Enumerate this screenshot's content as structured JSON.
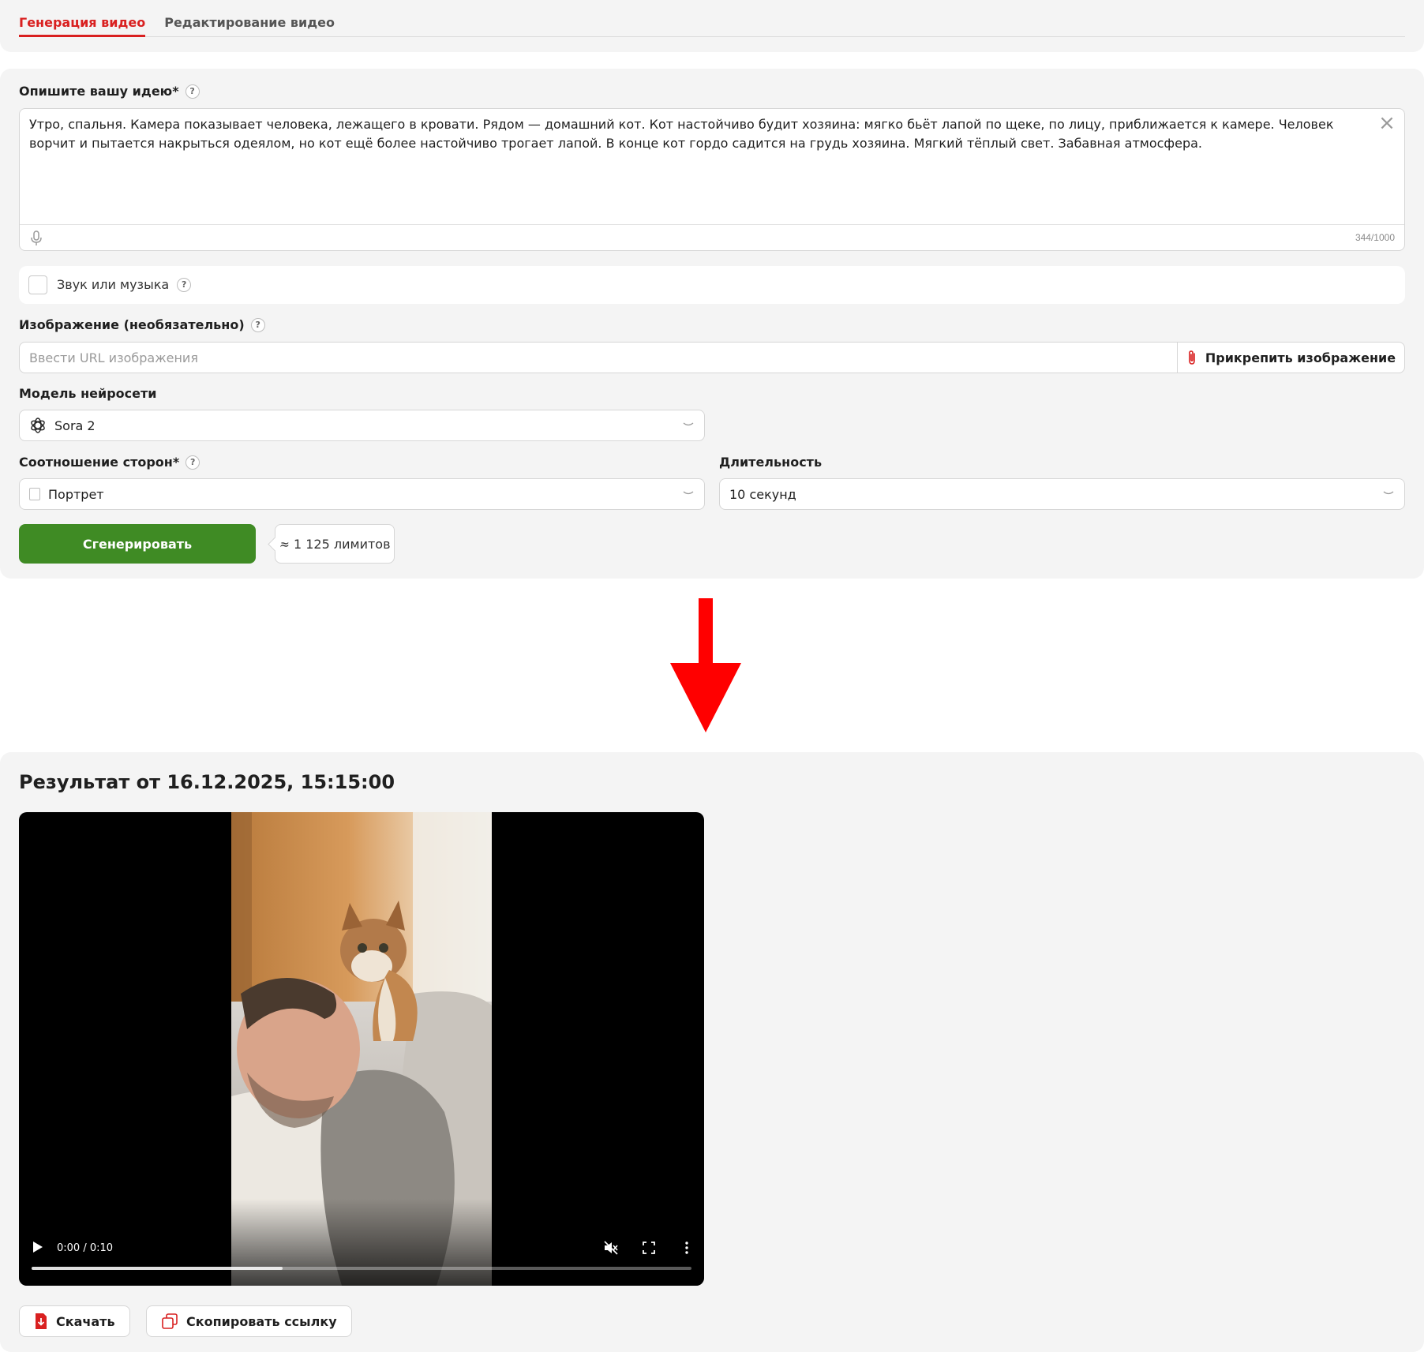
{
  "tabs": [
    {
      "label": "Генерация видео",
      "active": true
    },
    {
      "label": "Редактирование видео",
      "active": false
    }
  ],
  "idea": {
    "label": "Опишите вашу идею*",
    "help": "?",
    "value": "Утро, спальня. Камера показывает человека, лежащего в кровати. Рядом — домашний кот. Кот настойчиво будит хозяина: мягко бьёт лапой по щеке, по лицу, приближается к камере. Человек ворчит и пытается накрыться одеялом, но кот ещё более настойчиво трогает лапой. В конце кот гордо садится на грудь хозяина. Мягкий тёплый свет. Забавная атмосфера.",
    "counter": "344/1000",
    "clear_icon": "close-icon",
    "mic_icon": "microphone-icon"
  },
  "sound": {
    "label": "Звук или музыка",
    "help": "?",
    "checked": false
  },
  "image": {
    "label": "Изображение (необязательно)",
    "help": "?",
    "placeholder": "Ввести URL изображения",
    "attach_label": "Прикрепить изображение",
    "attach_icon": "paperclip-icon"
  },
  "model": {
    "label": "Модель нейросети",
    "value": "Sora 2",
    "icon": "openai-icon"
  },
  "aspect": {
    "label": "Соотношение сторон*",
    "help": "?",
    "value": "Портрет"
  },
  "duration": {
    "label": "Длительность",
    "value": "10 секунд"
  },
  "generate_label": "Сгенерировать",
  "limits_label": "≈ 1 125 лимитов",
  "colors": {
    "accent": "#d92020",
    "generate": "#3f8b24",
    "panel": "#f4f4f4",
    "arrow": "#ff0000"
  },
  "result": {
    "title": "Результат от 16.12.2025, 15:15:00",
    "video": {
      "time": "0:00 / 0:10",
      "progress": 0.38,
      "muted": true
    },
    "download_label": "Скачать",
    "copy_label": "Скопировать ссылку"
  }
}
